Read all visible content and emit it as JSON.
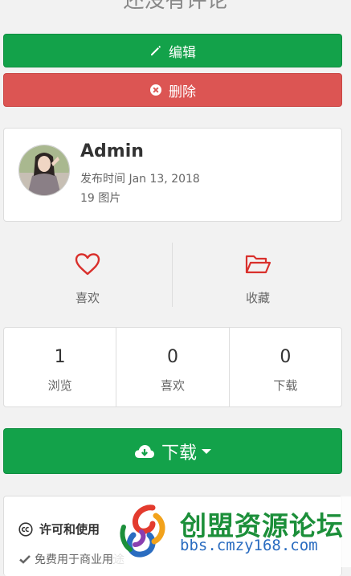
{
  "comments": {
    "empty_text": "还没有评论"
  },
  "actions": {
    "edit_label": "编辑",
    "delete_label": "删除"
  },
  "author": {
    "name": "Admin",
    "published": "发布时间 Jan 13, 2018",
    "image_count": "19 图片"
  },
  "reactions": {
    "like_label": "喜欢",
    "collect_label": "收藏"
  },
  "stats": [
    {
      "value": "1",
      "label": "浏览"
    },
    {
      "value": "0",
      "label": "喜欢"
    },
    {
      "value": "0",
      "label": "下载"
    }
  ],
  "download": {
    "label": "下载"
  },
  "license": {
    "title": "许可和使用",
    "item_1": "免费用于商业用途"
  },
  "watermark": {
    "name": "创盟资源论坛",
    "url": "bbs.cmzy168.com"
  },
  "colors": {
    "primary_green": "#13a24a",
    "danger_red": "#dc5553",
    "icon_red": "#d9302c"
  },
  "icons": [
    "pencil-icon",
    "times-circle-icon",
    "heart-outline-icon",
    "folder-open-icon",
    "cloud-download-icon",
    "creative-commons-icon",
    "check-icon"
  ]
}
